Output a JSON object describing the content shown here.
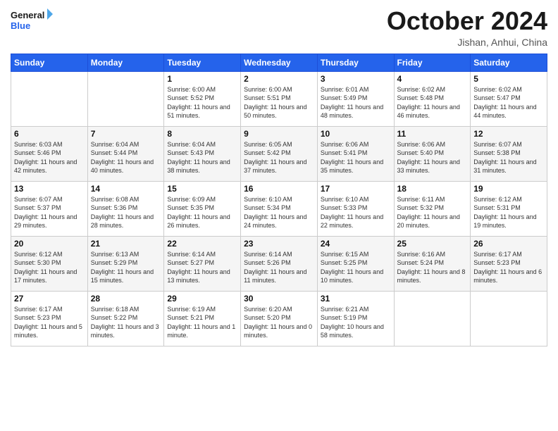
{
  "logo": {
    "text_general": "General",
    "text_blue": "Blue"
  },
  "header": {
    "month_year": "October 2024",
    "location": "Jishan, Anhui, China"
  },
  "days_of_week": [
    "Sunday",
    "Monday",
    "Tuesday",
    "Wednesday",
    "Thursday",
    "Friday",
    "Saturday"
  ],
  "weeks": [
    [
      {
        "day": "",
        "info": ""
      },
      {
        "day": "",
        "info": ""
      },
      {
        "day": "1",
        "info": "Sunrise: 6:00 AM\nSunset: 5:52 PM\nDaylight: 11 hours and 51 minutes."
      },
      {
        "day": "2",
        "info": "Sunrise: 6:00 AM\nSunset: 5:51 PM\nDaylight: 11 hours and 50 minutes."
      },
      {
        "day": "3",
        "info": "Sunrise: 6:01 AM\nSunset: 5:49 PM\nDaylight: 11 hours and 48 minutes."
      },
      {
        "day": "4",
        "info": "Sunrise: 6:02 AM\nSunset: 5:48 PM\nDaylight: 11 hours and 46 minutes."
      },
      {
        "day": "5",
        "info": "Sunrise: 6:02 AM\nSunset: 5:47 PM\nDaylight: 11 hours and 44 minutes."
      }
    ],
    [
      {
        "day": "6",
        "info": "Sunrise: 6:03 AM\nSunset: 5:46 PM\nDaylight: 11 hours and 42 minutes."
      },
      {
        "day": "7",
        "info": "Sunrise: 6:04 AM\nSunset: 5:44 PM\nDaylight: 11 hours and 40 minutes."
      },
      {
        "day": "8",
        "info": "Sunrise: 6:04 AM\nSunset: 5:43 PM\nDaylight: 11 hours and 38 minutes."
      },
      {
        "day": "9",
        "info": "Sunrise: 6:05 AM\nSunset: 5:42 PM\nDaylight: 11 hours and 37 minutes."
      },
      {
        "day": "10",
        "info": "Sunrise: 6:06 AM\nSunset: 5:41 PM\nDaylight: 11 hours and 35 minutes."
      },
      {
        "day": "11",
        "info": "Sunrise: 6:06 AM\nSunset: 5:40 PM\nDaylight: 11 hours and 33 minutes."
      },
      {
        "day": "12",
        "info": "Sunrise: 6:07 AM\nSunset: 5:38 PM\nDaylight: 11 hours and 31 minutes."
      }
    ],
    [
      {
        "day": "13",
        "info": "Sunrise: 6:07 AM\nSunset: 5:37 PM\nDaylight: 11 hours and 29 minutes."
      },
      {
        "day": "14",
        "info": "Sunrise: 6:08 AM\nSunset: 5:36 PM\nDaylight: 11 hours and 28 minutes."
      },
      {
        "day": "15",
        "info": "Sunrise: 6:09 AM\nSunset: 5:35 PM\nDaylight: 11 hours and 26 minutes."
      },
      {
        "day": "16",
        "info": "Sunrise: 6:10 AM\nSunset: 5:34 PM\nDaylight: 11 hours and 24 minutes."
      },
      {
        "day": "17",
        "info": "Sunrise: 6:10 AM\nSunset: 5:33 PM\nDaylight: 11 hours and 22 minutes."
      },
      {
        "day": "18",
        "info": "Sunrise: 6:11 AM\nSunset: 5:32 PM\nDaylight: 11 hours and 20 minutes."
      },
      {
        "day": "19",
        "info": "Sunrise: 6:12 AM\nSunset: 5:31 PM\nDaylight: 11 hours and 19 minutes."
      }
    ],
    [
      {
        "day": "20",
        "info": "Sunrise: 6:12 AM\nSunset: 5:30 PM\nDaylight: 11 hours and 17 minutes."
      },
      {
        "day": "21",
        "info": "Sunrise: 6:13 AM\nSunset: 5:29 PM\nDaylight: 11 hours and 15 minutes."
      },
      {
        "day": "22",
        "info": "Sunrise: 6:14 AM\nSunset: 5:27 PM\nDaylight: 11 hours and 13 minutes."
      },
      {
        "day": "23",
        "info": "Sunrise: 6:14 AM\nSunset: 5:26 PM\nDaylight: 11 hours and 11 minutes."
      },
      {
        "day": "24",
        "info": "Sunrise: 6:15 AM\nSunset: 5:25 PM\nDaylight: 11 hours and 10 minutes."
      },
      {
        "day": "25",
        "info": "Sunrise: 6:16 AM\nSunset: 5:24 PM\nDaylight: 11 hours and 8 minutes."
      },
      {
        "day": "26",
        "info": "Sunrise: 6:17 AM\nSunset: 5:23 PM\nDaylight: 11 hours and 6 minutes."
      }
    ],
    [
      {
        "day": "27",
        "info": "Sunrise: 6:17 AM\nSunset: 5:23 PM\nDaylight: 11 hours and 5 minutes."
      },
      {
        "day": "28",
        "info": "Sunrise: 6:18 AM\nSunset: 5:22 PM\nDaylight: 11 hours and 3 minutes."
      },
      {
        "day": "29",
        "info": "Sunrise: 6:19 AM\nSunset: 5:21 PM\nDaylight: 11 hours and 1 minute."
      },
      {
        "day": "30",
        "info": "Sunrise: 6:20 AM\nSunset: 5:20 PM\nDaylight: 11 hours and 0 minutes."
      },
      {
        "day": "31",
        "info": "Sunrise: 6:21 AM\nSunset: 5:19 PM\nDaylight: 10 hours and 58 minutes."
      },
      {
        "day": "",
        "info": ""
      },
      {
        "day": "",
        "info": ""
      }
    ]
  ]
}
